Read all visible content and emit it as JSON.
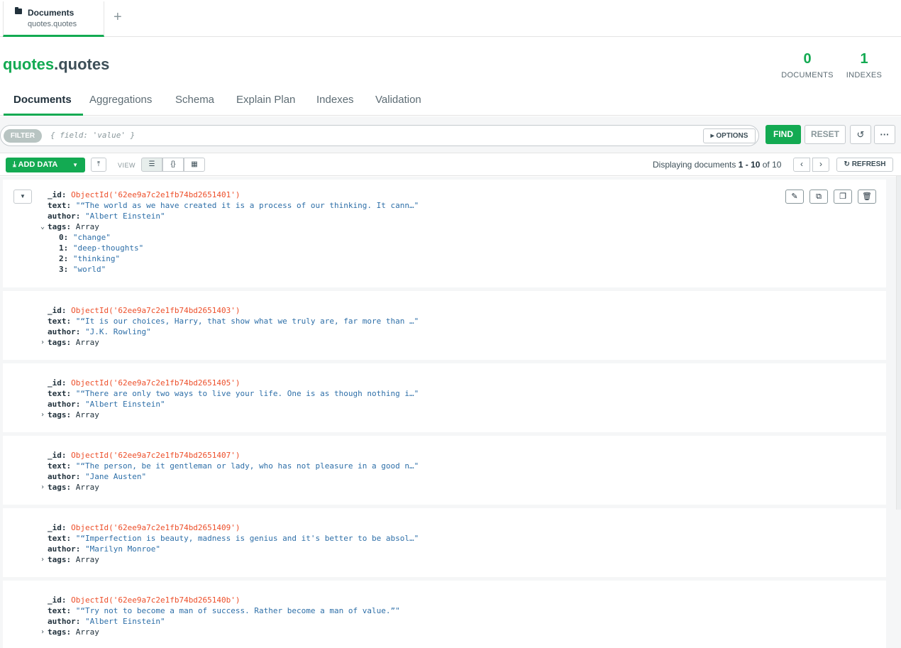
{
  "workspace_tab": {
    "title": "Documents",
    "subtitle": "quotes.quotes",
    "new_tab": "+"
  },
  "namespace": {
    "db": "quotes",
    "collection": ".quotes"
  },
  "stats": {
    "documents": {
      "value": "0",
      "label": "DOCUMENTS"
    },
    "indexes": {
      "value": "1",
      "label": "INDEXES"
    }
  },
  "tabs": [
    "Documents",
    "Aggregations",
    "Schema",
    "Explain Plan",
    "Indexes",
    "Validation"
  ],
  "query": {
    "filter_label": "FILTER",
    "placeholder": "{ field: 'value' }",
    "options": "▸ OPTIONS",
    "find": "FIND",
    "reset": "RESET",
    "history_icon": "↺",
    "more_icon": "···"
  },
  "toolbar": {
    "add_data": "ADD DATA",
    "view_label": "VIEW",
    "displaying_prefix": "Displaying documents ",
    "range": "1 - 10",
    "of": " of 10",
    "refresh": "REFRESH"
  },
  "documents": [
    {
      "id": "ObjectId('62ee9a7c2e1fb74bd2651401')",
      "text": "\"“The world as we have created it is a process of our thinking. It cann…\"",
      "author": "\"Albert Einstein\"",
      "tags": "Array",
      "expanded": true,
      "tag_items": [
        {
          "k": "0:",
          "v": "\"change\""
        },
        {
          "k": "1:",
          "v": "\"deep-thoughts\""
        },
        {
          "k": "2:",
          "v": "\"thinking\""
        },
        {
          "k": "3:",
          "v": "\"world\""
        }
      ]
    },
    {
      "id": "ObjectId('62ee9a7c2e1fb74bd2651403')",
      "text": "\"“It is our choices, Harry, that show what we truly are, far more than …\"",
      "author": "\"J.K. Rowling\"",
      "tags": "Array",
      "expanded": false
    },
    {
      "id": "ObjectId('62ee9a7c2e1fb74bd2651405')",
      "text": "\"“There are only two ways to live your life. One is as though nothing i…\"",
      "author": "\"Albert Einstein\"",
      "tags": "Array",
      "expanded": false
    },
    {
      "id": "ObjectId('62ee9a7c2e1fb74bd2651407')",
      "text": "\"“The person, be it gentleman or lady, who has not pleasure in a good n…\"",
      "author": "\"Jane Austen\"",
      "tags": "Array",
      "expanded": false
    },
    {
      "id": "ObjectId('62ee9a7c2e1fb74bd2651409')",
      "text": "\"“Imperfection is beauty, madness is genius and it's better to be absol…\"",
      "author": "\"Marilyn Monroe\"",
      "tags": "Array",
      "expanded": false
    },
    {
      "id": "ObjectId('62ee9a7c2e1fb74bd265140b')",
      "text": "\"“Try not to become a man of success. Rather become a man of value.”\"",
      "author": "\"Albert Einstein\"",
      "tags": "Array",
      "expanded": false
    }
  ],
  "labels": {
    "id_key": "_id:",
    "text_key": "text:",
    "author_key": "author:",
    "tags_key": "tags:"
  },
  "colors": {
    "accent": "#13aa52",
    "oid": "#ed4f2a",
    "string": "#2e6fa8"
  }
}
